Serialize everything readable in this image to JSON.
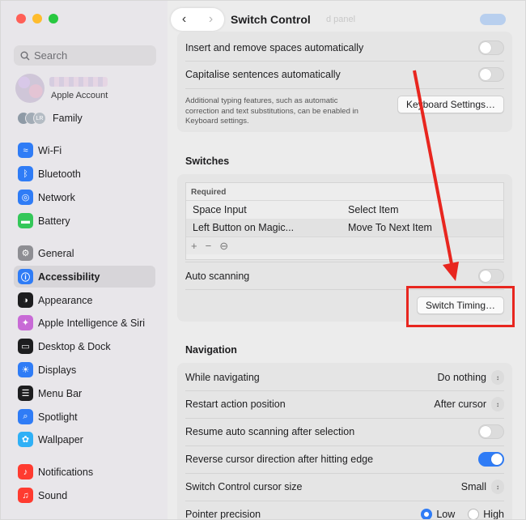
{
  "window": {
    "title": "Switch Control",
    "ghost_text": "d panel"
  },
  "sidebar": {
    "search_placeholder": "Search",
    "account_label": "Apple Account",
    "family": {
      "label": "Family",
      "initials": [
        "",
        "",
        "LR"
      ]
    },
    "items": [
      {
        "label": "Wi-Fi",
        "icon": "wifi-icon",
        "color": "#2f7cf6"
      },
      {
        "label": "Bluetooth",
        "icon": "bluetooth-icon",
        "color": "#2f7cf6"
      },
      {
        "label": "Network",
        "icon": "globe-icon",
        "color": "#2f7cf6"
      },
      {
        "label": "Battery",
        "icon": "battery-icon",
        "color": "#34c759"
      },
      {
        "label": "General",
        "icon": "gear-icon",
        "color": "#8e8e93"
      },
      {
        "label": "Accessibility",
        "icon": "accessibility-icon",
        "color": "#2f7cf6"
      },
      {
        "label": "Appearance",
        "icon": "appearance-icon",
        "color": "#1d1d1f"
      },
      {
        "label": "Apple Intelligence & Siri",
        "icon": "siri-icon",
        "color": "#c86ad6"
      },
      {
        "label": "Desktop & Dock",
        "icon": "dock-icon",
        "color": "#1d1d1f"
      },
      {
        "label": "Displays",
        "icon": "sun-icon",
        "color": "#2f7cf6"
      },
      {
        "label": "Menu Bar",
        "icon": "menubar-icon",
        "color": "#1d1d1f"
      },
      {
        "label": "Spotlight",
        "icon": "search-icon",
        "color": "#2f7cf6"
      },
      {
        "label": "Wallpaper",
        "icon": "flower-icon",
        "color": "#2fb0f6"
      },
      {
        "label": "Notifications",
        "icon": "bell-icon",
        "color": "#ff3b30"
      },
      {
        "label": "Sound",
        "icon": "speaker-icon",
        "color": "#ff3b30"
      }
    ],
    "active": "Accessibility"
  },
  "typing": {
    "insert_spaces": "Insert and remove spaces automatically",
    "capitalise": "Capitalise sentences automatically",
    "note": "Additional typing features, such as automatic correction and text substitutions, can be enabled in Keyboard settings.",
    "keyboard_button": "Keyboard Settings…"
  },
  "switches": {
    "heading": "Switches",
    "table_header": "Required",
    "rows": [
      {
        "switch": "Space Input",
        "action": "Select Item"
      },
      {
        "switch": "Left Button on Magic...",
        "action": "Move To Next Item"
      }
    ],
    "tools": [
      "+",
      "−",
      "⊖"
    ],
    "auto_scanning": "Auto scanning",
    "timing_button": "Switch Timing…"
  },
  "navigation": {
    "heading": "Navigation",
    "while_navigating": {
      "label": "While navigating",
      "value": "Do nothing"
    },
    "restart_action": {
      "label": "Restart action position",
      "value": "After cursor"
    },
    "resume_scanning": "Resume auto scanning after selection",
    "reverse_cursor": "Reverse cursor direction after hitting edge",
    "cursor_size": {
      "label": "Switch Control cursor size",
      "value": "Small"
    },
    "pointer_precision": {
      "label": "Pointer precision",
      "options": [
        "Low",
        "High"
      ],
      "selected": "Low"
    }
  },
  "colors": {
    "accent": "#2f7cf6",
    "annotation": "#e8261f"
  }
}
